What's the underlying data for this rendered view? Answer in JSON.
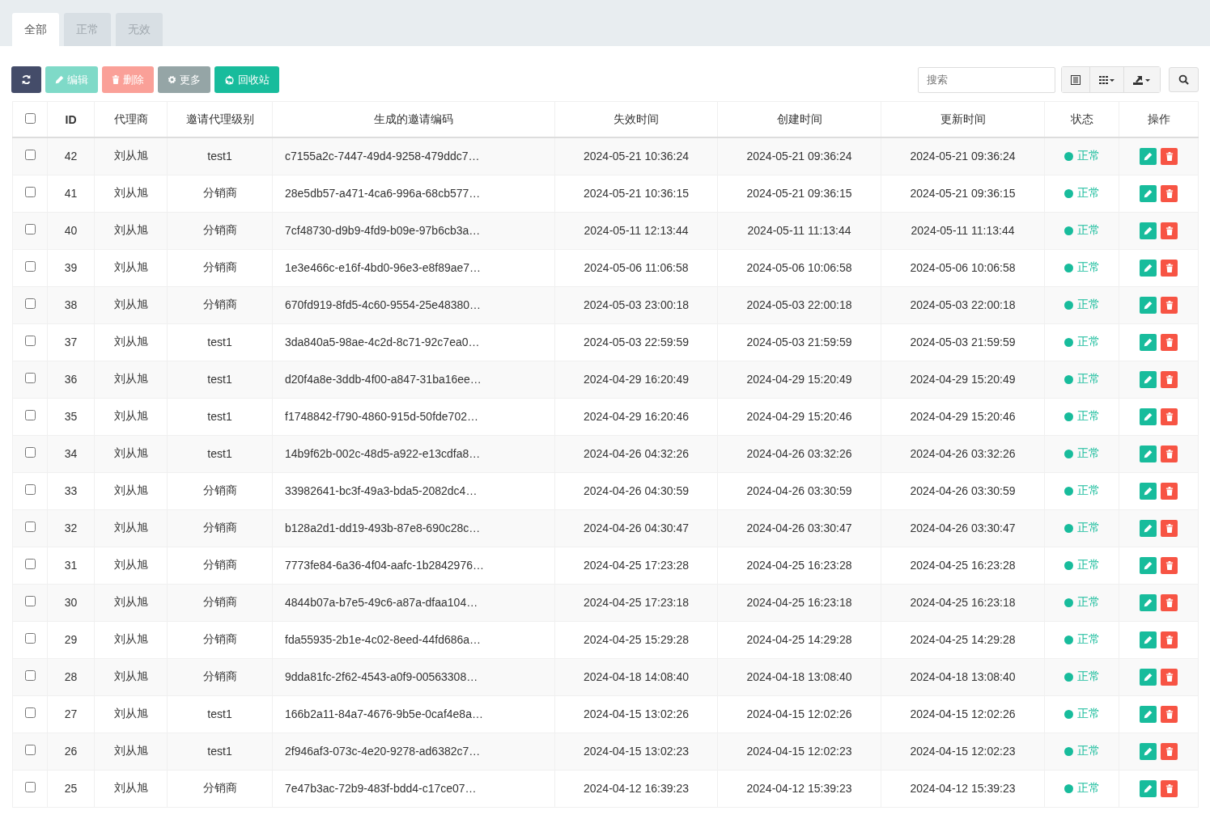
{
  "tabs": [
    {
      "label": "全部",
      "selected": true
    },
    {
      "label": "正常",
      "selected": false
    },
    {
      "label": "无效",
      "selected": false
    }
  ],
  "toolbar": {
    "buttons": [
      {
        "kind": "refresh",
        "disabled": false
      },
      {
        "kind": "edit",
        "label": "编辑",
        "disabled": true
      },
      {
        "kind": "delete",
        "label": "删除",
        "disabled": true
      },
      {
        "kind": "more",
        "label": "更多",
        "disabled": false
      },
      {
        "kind": "recycle",
        "label": "回收站",
        "disabled": false
      }
    ],
    "search": {
      "placeholder": "搜索"
    }
  },
  "table": {
    "select_all": {
      "checked": false
    },
    "columns": [
      "ID",
      "代理商",
      "邀请代理级别",
      "生成的邀请编码",
      "失效时间",
      "创建时间",
      "更新时间",
      "状态",
      "操作"
    ],
    "rows": [
      {
        "checked": false,
        "cells": [
          "42",
          "刘从旭",
          "test1",
          "c7155a2c-7447-49d4-9258-479ddc7…",
          "2024-05-21 10:36:24",
          "2024-05-21 09:36:24",
          "2024-05-21 09:36:24",
          "正常"
        ]
      },
      {
        "checked": false,
        "cells": [
          "41",
          "刘从旭",
          "分销商",
          "28e5db57-a471-4ca6-996a-68cb577…",
          "2024-05-21 10:36:15",
          "2024-05-21 09:36:15",
          "2024-05-21 09:36:15",
          "正常"
        ]
      },
      {
        "checked": false,
        "cells": [
          "40",
          "刘从旭",
          "分销商",
          "7cf48730-d9b9-4fd9-b09e-97b6cb3a…",
          "2024-05-11 12:13:44",
          "2024-05-11 11:13:44",
          "2024-05-11 11:13:44",
          "正常"
        ]
      },
      {
        "checked": false,
        "cells": [
          "39",
          "刘从旭",
          "分销商",
          "1e3e466c-e16f-4bd0-96e3-e8f89ae7…",
          "2024-05-06 11:06:58",
          "2024-05-06 10:06:58",
          "2024-05-06 10:06:58",
          "正常"
        ]
      },
      {
        "checked": false,
        "cells": [
          "38",
          "刘从旭",
          "分销商",
          "670fd919-8fd5-4c60-9554-25e48380…",
          "2024-05-03 23:00:18",
          "2024-05-03 22:00:18",
          "2024-05-03 22:00:18",
          "正常"
        ]
      },
      {
        "checked": false,
        "cells": [
          "37",
          "刘从旭",
          "test1",
          "3da840a5-98ae-4c2d-8c71-92c7ea0…",
          "2024-05-03 22:59:59",
          "2024-05-03 21:59:59",
          "2024-05-03 21:59:59",
          "正常"
        ]
      },
      {
        "checked": false,
        "cells": [
          "36",
          "刘从旭",
          "test1",
          "d20f4a8e-3ddb-4f00-a847-31ba16ee…",
          "2024-04-29 16:20:49",
          "2024-04-29 15:20:49",
          "2024-04-29 15:20:49",
          "正常"
        ]
      },
      {
        "checked": false,
        "cells": [
          "35",
          "刘从旭",
          "test1",
          "f1748842-f790-4860-915d-50fde702…",
          "2024-04-29 16:20:46",
          "2024-04-29 15:20:46",
          "2024-04-29 15:20:46",
          "正常"
        ]
      },
      {
        "checked": false,
        "cells": [
          "34",
          "刘从旭",
          "test1",
          "14b9f62b-002c-48d5-a922-e13cdfa8…",
          "2024-04-26 04:32:26",
          "2024-04-26 03:32:26",
          "2024-04-26 03:32:26",
          "正常"
        ]
      },
      {
        "checked": false,
        "cells": [
          "33",
          "刘从旭",
          "分销商",
          "33982641-bc3f-49a3-bda5-2082dc4…",
          "2024-04-26 04:30:59",
          "2024-04-26 03:30:59",
          "2024-04-26 03:30:59",
          "正常"
        ]
      },
      {
        "checked": false,
        "cells": [
          "32",
          "刘从旭",
          "分销商",
          "b128a2d1-dd19-493b-87e8-690c28c…",
          "2024-04-26 04:30:47",
          "2024-04-26 03:30:47",
          "2024-04-26 03:30:47",
          "正常"
        ]
      },
      {
        "checked": false,
        "cells": [
          "31",
          "刘从旭",
          "分销商",
          "7773fe84-6a36-4f04-aafc-1b2842976…",
          "2024-04-25 17:23:28",
          "2024-04-25 16:23:28",
          "2024-04-25 16:23:28",
          "正常"
        ]
      },
      {
        "checked": false,
        "cells": [
          "30",
          "刘从旭",
          "分销商",
          "4844b07a-b7e5-49c6-a87a-dfaa104…",
          "2024-04-25 17:23:18",
          "2024-04-25 16:23:18",
          "2024-04-25 16:23:18",
          "正常"
        ]
      },
      {
        "checked": false,
        "cells": [
          "29",
          "刘从旭",
          "分销商",
          "fda55935-2b1e-4c02-8eed-44fd686a…",
          "2024-04-25 15:29:28",
          "2024-04-25 14:29:28",
          "2024-04-25 14:29:28",
          "正常"
        ]
      },
      {
        "checked": false,
        "cells": [
          "28",
          "刘从旭",
          "分销商",
          "9dda81fc-2f62-4543-a0f9-00563308…",
          "2024-04-18 14:08:40",
          "2024-04-18 13:08:40",
          "2024-04-18 13:08:40",
          "正常"
        ]
      },
      {
        "checked": false,
        "cells": [
          "27",
          "刘从旭",
          "test1",
          "166b2a11-84a7-4676-9b5e-0caf4e8a…",
          "2024-04-15 13:02:26",
          "2024-04-15 12:02:26",
          "2024-04-15 12:02:26",
          "正常"
        ]
      },
      {
        "checked": false,
        "cells": [
          "26",
          "刘从旭",
          "test1",
          "2f946af3-073c-4e20-9278-ad6382c7…",
          "2024-04-15 13:02:23",
          "2024-04-15 12:02:23",
          "2024-04-15 12:02:23",
          "正常"
        ]
      },
      {
        "checked": false,
        "cells": [
          "25",
          "刘从旭",
          "分销商",
          "7e47b3ac-72b9-483f-bdd4-c17ce07…",
          "2024-04-12 16:39:23",
          "2024-04-12 15:39:23",
          "2024-04-12 15:39:23",
          "正常"
        ]
      }
    ]
  }
}
